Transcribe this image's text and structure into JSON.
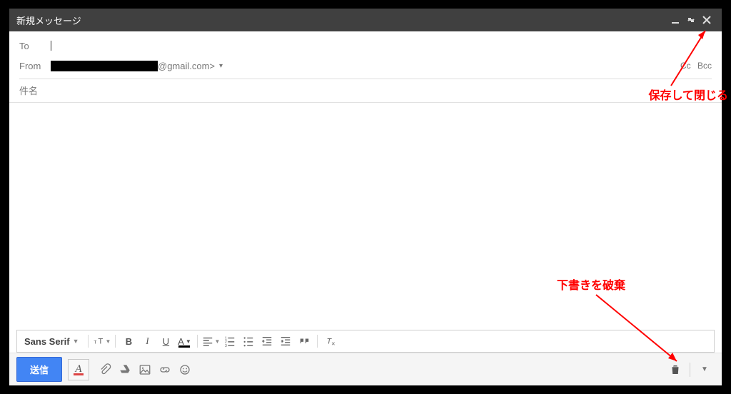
{
  "window": {
    "title": "新規メッセージ"
  },
  "headers": {
    "to_label": "To",
    "from_label": "From",
    "from_suffix": "@gmail.com>",
    "cc_label": "Cc",
    "bcc_label": "Bcc"
  },
  "subject": {
    "placeholder": "件名"
  },
  "format": {
    "font_name": "Sans Serif",
    "size_label": "T",
    "bold": "B",
    "italic": "I",
    "underline": "U",
    "text_color": "A"
  },
  "actions": {
    "send_label": "送信",
    "format_toggle": "A"
  },
  "annotations": {
    "save_close": "保存して閉じる",
    "discard_draft": "下書きを破棄"
  }
}
